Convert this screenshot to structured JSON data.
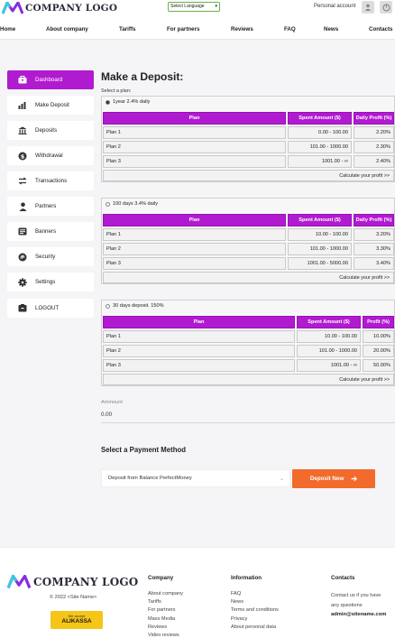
{
  "header": {
    "logo_text": "COMPANY LOGO",
    "language_select": "Select Language",
    "personal_account": "Personal account"
  },
  "nav": [
    "Home",
    "About company",
    "Tariffs",
    "For partners",
    "Reviews",
    "FAQ",
    "News",
    "Contacts"
  ],
  "sidebar": [
    {
      "label": "Dashboard",
      "icon": "dashboard-icon",
      "active": true
    },
    {
      "label": "Make Deposit",
      "icon": "bar-chart-icon",
      "active": false
    },
    {
      "label": "Deposits",
      "icon": "bank-icon",
      "active": false
    },
    {
      "label": "Withdrawal",
      "icon": "dollar-icon",
      "active": false
    },
    {
      "label": "Transactions",
      "icon": "transfer-icon",
      "active": false
    },
    {
      "label": "Partners",
      "icon": "user-icon",
      "active": false
    },
    {
      "label": "Banners",
      "icon": "banner-icon",
      "active": false
    },
    {
      "label": "Security",
      "icon": "fingerprint-icon",
      "active": false
    },
    {
      "label": "Settings",
      "icon": "gear-icon",
      "active": false
    },
    {
      "label": "LOGOUT",
      "icon": "logout-icon",
      "active": false
    }
  ],
  "main": {
    "title": "Make a Deposit:",
    "select_plan_label": "Select a plan:",
    "plans": [
      {
        "name": "1year 2.4% daily",
        "selected": true,
        "headers": [
          "Plan",
          "Spent Amount ($)",
          "Daily Profit (%)"
        ],
        "rows": [
          [
            "Plan 1",
            "0.00 - 100.00",
            "2.20%"
          ],
          [
            "Plan 2",
            "101.00 - 1000.00",
            "2.30%"
          ],
          [
            "Plan 3",
            "1001.00 - ∞",
            "2.40%"
          ]
        ],
        "calc": "Calculate your profit >>"
      },
      {
        "name": "100 days 3.4% daily",
        "selected": false,
        "headers": [
          "Plan",
          "Spent Amount ($)",
          "Daily Profit (%)"
        ],
        "rows": [
          [
            "Plan 1",
            "10.00 - 100.00",
            "3.20%"
          ],
          [
            "Plan 2",
            "101.00 - 1000.00",
            "3.30%"
          ],
          [
            "Plan 3",
            "1001.00 - 5000.00",
            "3.40%"
          ]
        ],
        "calc": "Calculate your profit >>"
      },
      {
        "name": "30 days deposit. 150%",
        "selected": false,
        "headers": [
          "Plan",
          "Spent Amount ($)",
          "Profit (%)"
        ],
        "rows": [
          [
            "Plan 1",
            "10.00 - 100.00",
            "10.00%"
          ],
          [
            "Plan 2",
            "101.00 - 1000.00",
            "20.00%"
          ],
          [
            "Plan 3",
            "1001.00 - ∞",
            "50.00%"
          ]
        ],
        "calc": "Calculate your profit >>"
      }
    ],
    "amount_label": "Ammount",
    "amount_value": "0.00",
    "payment_title": "Select a Payment Method",
    "payment_option": "Deposit from Balance PerfectMoney",
    "deposit_button": "Deposit Now"
  },
  "footer": {
    "logo_text": "COMPANY LOGO",
    "copyright": "© 2022 <Site Name>",
    "badge_top": "We accept",
    "badge_name": "ALIKASSA",
    "company_title": "Company",
    "company_links": [
      "About company",
      "Tariffs",
      "For partners",
      "Mass Media",
      "Reviews",
      "Video reviews"
    ],
    "info_title": "Information",
    "info_links": [
      "FAQ",
      "News",
      "Terms and conditions",
      "Privacy",
      "About personal data"
    ],
    "contacts_title": "Contacts",
    "contacts_text_1": "Contact us if you have",
    "contacts_text_2": "any questions",
    "contacts_email": "admin@sitename.com"
  },
  "colors": {
    "accent": "#b11bd0",
    "button": "#f26b2d",
    "badge": "#f5c518"
  }
}
